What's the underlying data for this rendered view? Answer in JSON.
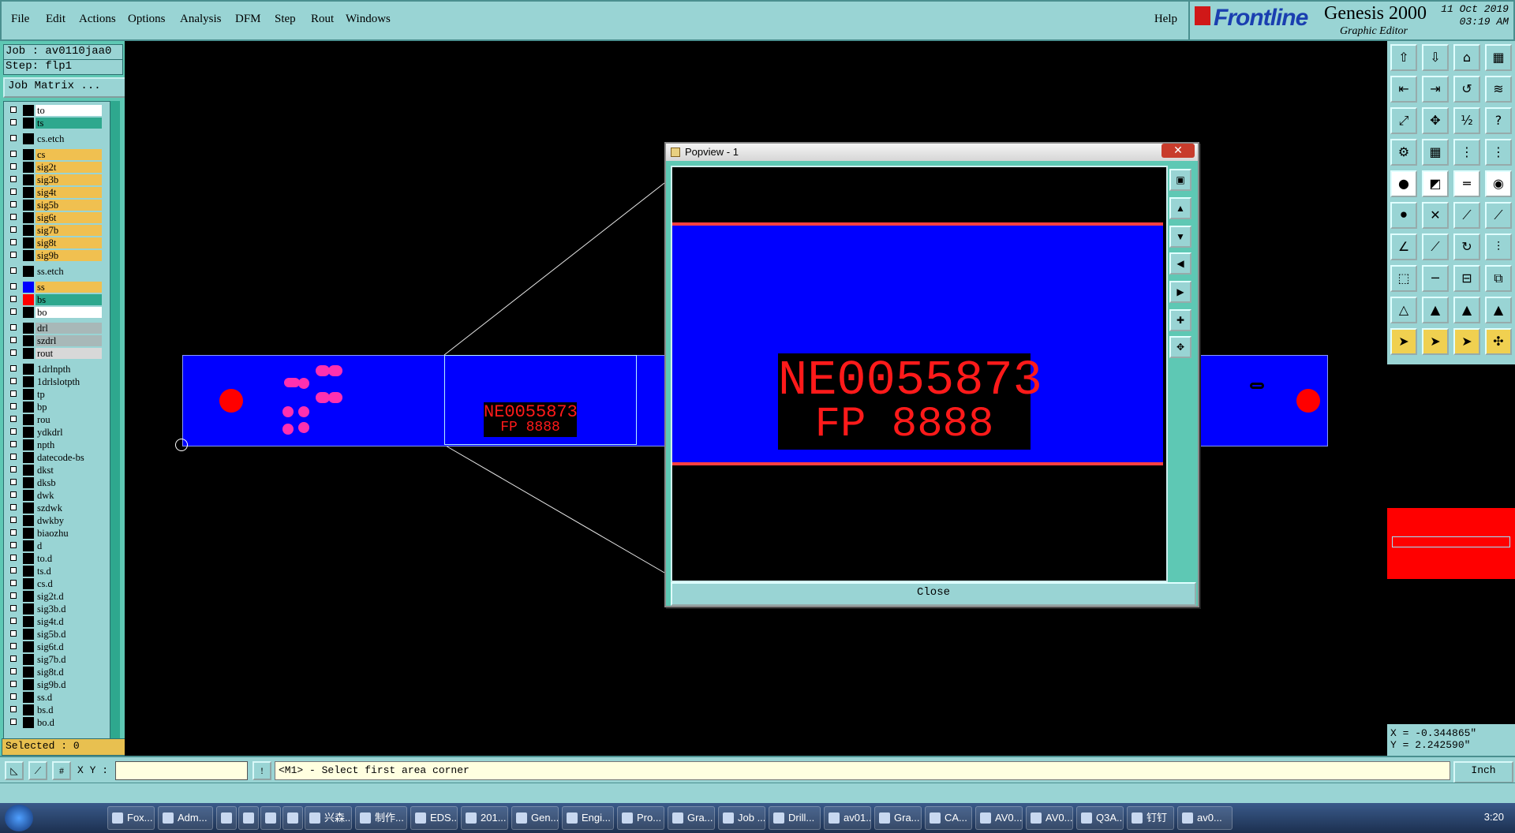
{
  "menu": {
    "items": [
      "File",
      "Edit",
      "Actions",
      "Options",
      "Analysis",
      "DFM",
      "Step",
      "Rout",
      "Windows"
    ],
    "help": "Help"
  },
  "brand": {
    "logo": "Frontline",
    "product": "Genesis 2000",
    "subtitle": "Graphic Editor",
    "date": "11 Oct 2019",
    "time": "03:19 AM"
  },
  "job": {
    "job_line": "Job : av0110jaa0",
    "step_line": "Step: flp1",
    "matrix_button": "Job Matrix ..."
  },
  "layers": [
    {
      "name": "to",
      "color": "#ffffff",
      "swatch": "#000000"
    },
    {
      "name": "ts",
      "color": "#2ea88e",
      "swatch": "#000000"
    },
    {
      "name": "cs.etch",
      "color": "#99d4d4",
      "swatch": "#000000"
    },
    {
      "name": "cs",
      "color": "#f0c050",
      "swatch": "#000000"
    },
    {
      "name": "sig2t",
      "color": "#f0c050",
      "swatch": "#000000"
    },
    {
      "name": "sig3b",
      "color": "#f0c050",
      "swatch": "#000000"
    },
    {
      "name": "sig4t",
      "color": "#f0c050",
      "swatch": "#000000"
    },
    {
      "name": "sig5b",
      "color": "#f0c050",
      "swatch": "#000000"
    },
    {
      "name": "sig6t",
      "color": "#f0c050",
      "swatch": "#000000"
    },
    {
      "name": "sig7b",
      "color": "#f0c050",
      "swatch": "#000000"
    },
    {
      "name": "sig8t",
      "color": "#f0c050",
      "swatch": "#000000"
    },
    {
      "name": "sig9b",
      "color": "#f0c050",
      "swatch": "#000000"
    },
    {
      "name": "ss.etch",
      "color": "#99d4d4",
      "swatch": "#000000"
    },
    {
      "name": "ss",
      "color": "#f0c050",
      "swatch": "#0000ff"
    },
    {
      "name": "bs",
      "color": "#2ea88e",
      "swatch": "#ff0000"
    },
    {
      "name": "bo",
      "color": "#ffffff",
      "swatch": "#000000"
    },
    {
      "name": "drl",
      "color": "#a8b8b8",
      "swatch": "#000000"
    },
    {
      "name": "szdrl",
      "color": "#a8b8b8",
      "swatch": "#000000"
    },
    {
      "name": "rout",
      "color": "#d8d8d8",
      "swatch": "#000000"
    },
    {
      "name": "1drlnpth",
      "color": "#99d4d4",
      "swatch": "#000000"
    },
    {
      "name": "1drlslotpth",
      "color": "#99d4d4",
      "swatch": "#000000"
    },
    {
      "name": "tp",
      "color": "#99d4d4",
      "swatch": "#000000"
    },
    {
      "name": "bp",
      "color": "#99d4d4",
      "swatch": "#000000"
    },
    {
      "name": "rou",
      "color": "#99d4d4",
      "swatch": "#000000"
    },
    {
      "name": "ydkdrl",
      "color": "#99d4d4",
      "swatch": "#000000"
    },
    {
      "name": "npth",
      "color": "#99d4d4",
      "swatch": "#000000"
    },
    {
      "name": "datecode-bs",
      "color": "#99d4d4",
      "swatch": "#000000"
    },
    {
      "name": "dkst",
      "color": "#99d4d4",
      "swatch": "#000000"
    },
    {
      "name": "dksb",
      "color": "#99d4d4",
      "swatch": "#000000"
    },
    {
      "name": "dwk",
      "color": "#99d4d4",
      "swatch": "#000000"
    },
    {
      "name": "szdwk",
      "color": "#99d4d4",
      "swatch": "#000000"
    },
    {
      "name": "dwkby",
      "color": "#99d4d4",
      "swatch": "#000000"
    },
    {
      "name": "biaozhu",
      "color": "#99d4d4",
      "swatch": "#000000"
    },
    {
      "name": "d",
      "color": "#99d4d4",
      "swatch": "#000000"
    },
    {
      "name": "to.d",
      "color": "#99d4d4",
      "swatch": "#000000"
    },
    {
      "name": "ts.d",
      "color": "#99d4d4",
      "swatch": "#000000"
    },
    {
      "name": "cs.d",
      "color": "#99d4d4",
      "swatch": "#000000"
    },
    {
      "name": "sig2t.d",
      "color": "#99d4d4",
      "swatch": "#000000"
    },
    {
      "name": "sig3b.d",
      "color": "#99d4d4",
      "swatch": "#000000"
    },
    {
      "name": "sig4t.d",
      "color": "#99d4d4",
      "swatch": "#000000"
    },
    {
      "name": "sig5b.d",
      "color": "#99d4d4",
      "swatch": "#000000"
    },
    {
      "name": "sig6t.d",
      "color": "#99d4d4",
      "swatch": "#000000"
    },
    {
      "name": "sig7b.d",
      "color": "#99d4d4",
      "swatch": "#000000"
    },
    {
      "name": "sig8t.d",
      "color": "#99d4d4",
      "swatch": "#000000"
    },
    {
      "name": "sig9b.d",
      "color": "#99d4d4",
      "swatch": "#000000"
    },
    {
      "name": "ss.d",
      "color": "#99d4d4",
      "swatch": "#000000"
    },
    {
      "name": "bs.d",
      "color": "#99d4d4",
      "swatch": "#000000"
    },
    {
      "name": "bo.d",
      "color": "#99d4d4",
      "swatch": "#000000"
    }
  ],
  "selected": "Selected : 0",
  "canvas": {
    "board_text_line1": "NE0055873",
    "board_text_line2": "FP 8888"
  },
  "popview": {
    "title": "Popview - 1",
    "close_x": "✕",
    "close_button": "Close",
    "text_line1": "NE0055873",
    "text_line2": "FP 8888"
  },
  "command": {
    "xy_label": "X Y :",
    "xy_value": "",
    "prompt": "<M1> - Select first area corner",
    "units": "Inch"
  },
  "coordinates": {
    "x": "X = -0.344865\"",
    "y": "Y = 2.242590\""
  },
  "taskbar": {
    "items": [
      "Fox...",
      "Adm...",
      "",
      "",
      "",
      "",
      "兴森...",
      "制作...",
      "EDS...",
      "201...",
      "Gen...",
      "Engi...",
      "Pro...",
      "Gra...",
      "Job ...",
      "Drill...",
      "av01...",
      "Gra...",
      "CA...",
      "AV0...",
      "AV0...",
      "Q3A...",
      "钉钉",
      "av0..."
    ],
    "clock": "3:20"
  }
}
